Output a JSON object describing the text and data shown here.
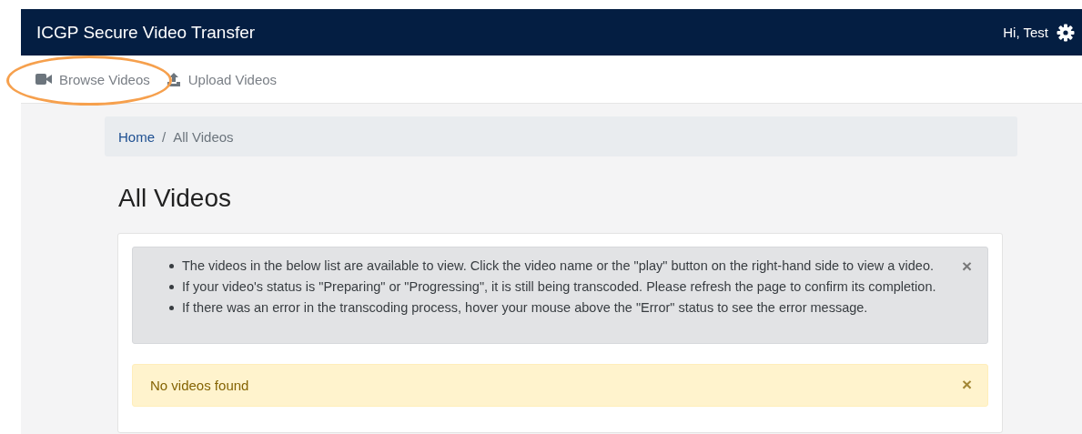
{
  "navbar": {
    "title": "ICGP Secure Video Transfer",
    "greeting": "Hi, Test"
  },
  "subnav": {
    "items": [
      {
        "label": "Browse Videos",
        "kind": "video"
      },
      {
        "label": "Upload Videos",
        "kind": "upload"
      }
    ]
  },
  "breadcrumb": [
    {
      "label": "Home",
      "kind": "link"
    },
    {
      "label": "All Videos",
      "kind": "current"
    }
  ],
  "breadcrumb_separator": "/",
  "heading": "All Videos",
  "alerts": [
    {
      "kind": "info",
      "close": "×",
      "items": [
        "The videos in the below list are available to view. Click the video name or the \"play\" button on the right-hand side to view a video.",
        "If your video's status is \"Preparing\" or \"Progressing\", it is still being transcoded. Please refresh the page to confirm its completion.",
        "If there was an error in the transcoding process, hover your mouse above the \"Error\" status to see the error message."
      ]
    },
    {
      "kind": "warning",
      "close": "×",
      "text": "No videos found"
    }
  ]
}
